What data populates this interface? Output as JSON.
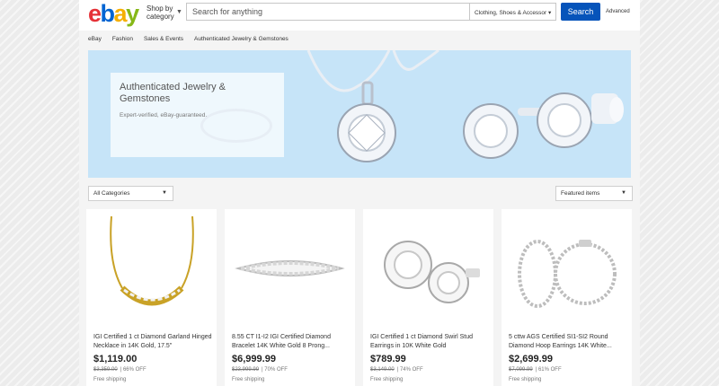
{
  "header": {
    "logo": [
      "e",
      "b",
      "a",
      "y"
    ],
    "shop_by_line1": "Shop by",
    "shop_by_line2": "category",
    "search_placeholder": "Search for anything",
    "search_category": "Clothing, Shoes & Accessor",
    "search_button": "Search",
    "advanced": "Advanced"
  },
  "breadcrumbs": [
    "eBay",
    "Fashion",
    "Sales & Events",
    "Authenticated Jewelry & Gemstones"
  ],
  "banner": {
    "title": "Authenticated Jewelry & Gemstones",
    "subtitle": "Expert-verified, eBay-guaranteed."
  },
  "filters": {
    "category": "All Categories",
    "sort": "Featured items"
  },
  "products": [
    {
      "title": "IGI Certified 1 ct Diamond Garland Hinged Necklace in 14K Gold, 17.5\"",
      "price": "$1,119.00",
      "original_price": "$3,359.00",
      "discount": "66% OFF",
      "shipping": "Free shipping",
      "image": "necklace-icon"
    },
    {
      "title": "8.55 CT I1-I2 IGI Certified Diamond Bracelet 14K White Gold 8 Prong...",
      "price": "$6,999.99",
      "original_price": "$23,999.99",
      "discount": "70% OFF",
      "shipping": "Free shipping",
      "image": "bracelet-icon"
    },
    {
      "title": "IGI Certified 1 ct Diamond Swirl Stud Earrings in 10K White Gold",
      "price": "$789.99",
      "original_price": "$3,149.00",
      "discount": "74% OFF",
      "shipping": "Free shipping",
      "image": "earrings-icon"
    },
    {
      "title": "5 cttw AGS Certified SI1-SI2 Round Diamond Hoop Earrings 14K White...",
      "price": "$2,699.99",
      "original_price": "$7,099.99",
      "discount": "61% OFF",
      "shipping": "Free shipping",
      "image": "hoop-earrings-icon"
    }
  ],
  "colors": {
    "search_button": "#0654ba",
    "banner_bg": "#c6e4f8",
    "logo_red": "#e53238",
    "logo_blue": "#0064d2",
    "logo_yellow": "#f5af02",
    "logo_green": "#86b817"
  }
}
